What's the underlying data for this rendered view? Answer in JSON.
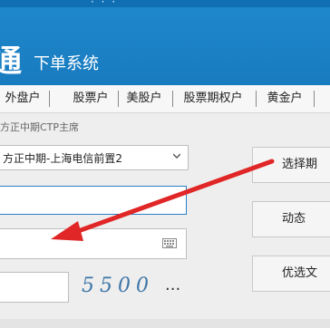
{
  "header": {
    "topbar_text": "· · ·",
    "logo_char": "通",
    "subtitle": "下单系统"
  },
  "tabs": [
    {
      "label": "外盘户"
    },
    {
      "label": "股票户"
    },
    {
      "label": "美股户"
    },
    {
      "label": "股票期权户"
    },
    {
      "label": "黄金户"
    }
  ],
  "broker": {
    "label": "方正中期CTP主席",
    "selected": "方正中期-上海电信前置2"
  },
  "captcha": {
    "code": "5500",
    "more": "..."
  },
  "buttons": {
    "select_server": "选择期",
    "dynamic": "动态",
    "preferred": "优选文"
  },
  "colors": {
    "header_blue": "#1f87cc",
    "arrow_red": "#e02626",
    "focus_border": "#2c7fc7"
  },
  "icons": [
    "chevron-down-icon",
    "keyboard-icon",
    "arrow-annotation"
  ]
}
